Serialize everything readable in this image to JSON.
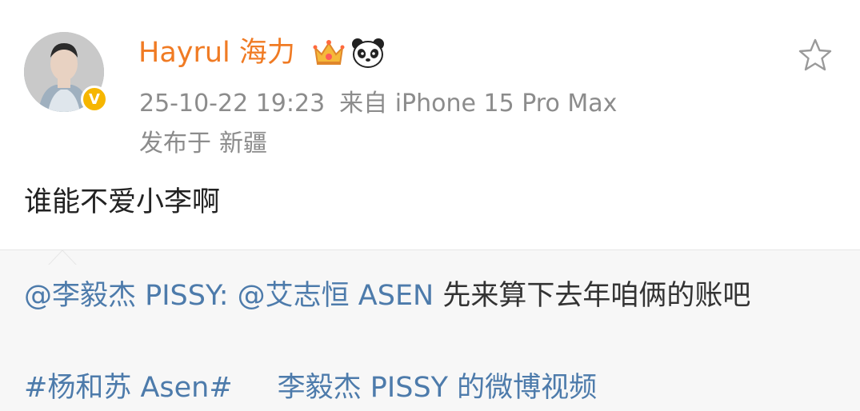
{
  "post": {
    "username": "Hayrul 海力",
    "badges": [
      "crown-badge",
      "panda-badge"
    ],
    "verified_mark": "V",
    "timestamp": "25-10-22 19:23",
    "source": "来自 iPhone 15 Pro Max",
    "location_label": "发布于",
    "location": "新疆",
    "text": "谁能不爱小李啊"
  },
  "repost": {
    "author_mention": "@李毅杰 PISSY",
    "colon": ":",
    "mention": "@艾志恒 ASEN",
    "text": "先来算下去年咱俩的账吧",
    "hashtag": "#杨和苏 Asen#",
    "video_link": "李毅杰 PISSY 的微博视频"
  },
  "colors": {
    "username": "#f07b24",
    "link": "#4d7bab",
    "meta": "#8c8c8c",
    "repost_bg": "#f7f7f7",
    "verified": "#f6b600"
  },
  "icons": [
    "avatar",
    "verified-badge",
    "crown-icon",
    "panda-icon",
    "favorite-star-icon"
  ]
}
